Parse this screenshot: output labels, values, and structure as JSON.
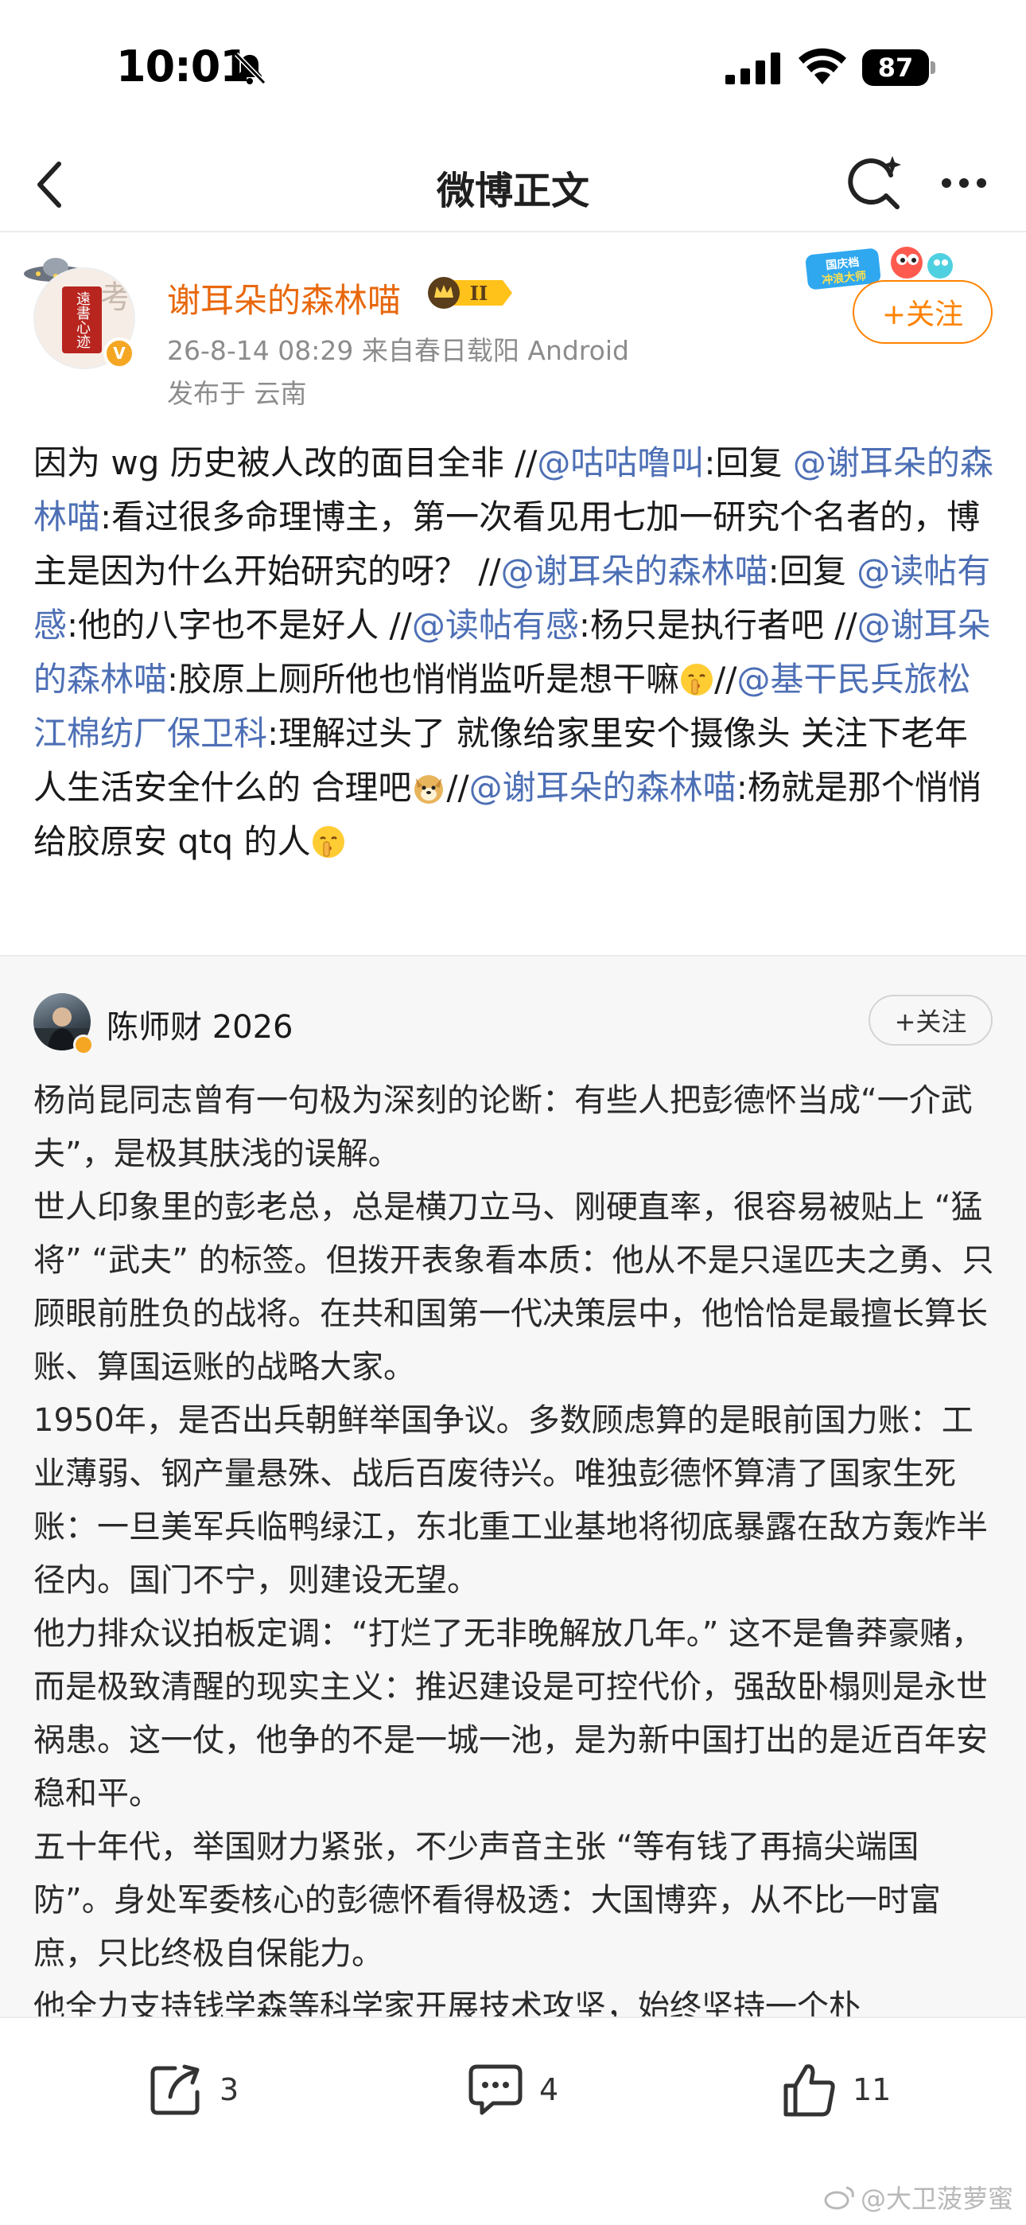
{
  "status_bar": {
    "time": "10:01",
    "battery": "87",
    "icons": [
      "bell-off-icon",
      "signal-icon",
      "wifi-icon",
      "battery-icon"
    ]
  },
  "nav": {
    "title": "微博正文",
    "icons": [
      "back-icon",
      "ai-search-icon",
      "more-icon"
    ]
  },
  "author": {
    "name": "谢耳朵的森林喵",
    "level_badge": "II",
    "meta": "26-8-14 08:29  来自春日载阳 Android",
    "location": "发布于 云南",
    "follow_label": "+关注",
    "avatar_seal_text": "遠書心迹",
    "promo_text": "国庆档冲浪大师"
  },
  "repost_text": [
    {
      "t": "因为 wg 历史被人改的面目全非 //"
    },
    {
      "m": "@咕咕噜叫"
    },
    {
      "t": ":回复 "
    },
    {
      "m": "@谢耳朵的森林喵"
    },
    {
      "t": ":看过很多命理博主，第一次看见用七加一研究个名者的，博主是因为什么开始研究的呀？ //"
    },
    {
      "m": "@谢耳朵的森林喵"
    },
    {
      "t": ":回复 "
    },
    {
      "m": "@读帖有感"
    },
    {
      "t": ":他的八字也不是好人 //"
    },
    {
      "m": "@读帖有感"
    },
    {
      "t": ":杨只是执行者吧 //"
    },
    {
      "m": "@谢耳朵的森林喵"
    },
    {
      "t": ":胶原上厕所他也悄悄监听是想干嘛"
    },
    {
      "e": "shush-emoji"
    },
    {
      "t": "//"
    },
    {
      "m": "@基干民兵旅松江棉纺厂保卫科"
    },
    {
      "t": ":理解过头了 就像给家里安个摄像头 关注下老年人生活安全什么的 合理吧"
    },
    {
      "e": "doge-emoji"
    },
    {
      "t": "//"
    },
    {
      "m": "@谢耳朵的森林喵"
    },
    {
      "t": ":杨就是那个悄悄给胶原安 qtq 的人"
    },
    {
      "e": "shush-emoji"
    }
  ],
  "original": {
    "name": "陈师财 2026",
    "follow_label": "+关注",
    "paragraphs": [
      "杨尚昆同志曾有一句极为深刻的论断：有些人把彭德怀当成“一介武夫”，是极其肤浅的误解。",
      "世人印象里的彭老总，总是横刀立马、刚硬直率，很容易被贴上 “猛将” “武夫” 的标签。但拨开表象看本质：他从不是只逞匹夫之勇、只顾眼前胜负的战将。在共和国第一代决策层中，他恰恰是最擅长算长账、算国运账的战略大家。",
      "1950年，是否出兵朝鲜举国争议。多数顾虑算的是眼前国力账：工业薄弱、钢产量悬殊、战后百废待兴。唯独彭德怀算清了国家生死账：一旦美军兵临鸭绿江，东北重工业基地将彻底暴露在敌方轰炸半径内。国门不宁，则建设无望。",
      "他力排众议拍板定调：“打烂了无非晚解放几年。” 这不是鲁莽豪赌，而是极致清醒的现实主义：推迟建设是可控代价，强敌卧榻则是永世祸患。这一仗，他争的不是一城一池，是为新中国打出的是近百年安稳和平。",
      "五十年代，举国财力紧张，不少声音主张 “等有钱了再搞尖端国防”。身处军委核心的彭德怀看得极透：大国博弈，从不比一时富庶，只比终极自保能力。",
      "他全力支持钱学森等科学家开展技术攻坚，始终坚持一个朴"
    ]
  },
  "actions": {
    "repost_count": "3",
    "comment_count": "4",
    "like_count": "11"
  },
  "watermark": "@大卫菠萝蜜"
}
